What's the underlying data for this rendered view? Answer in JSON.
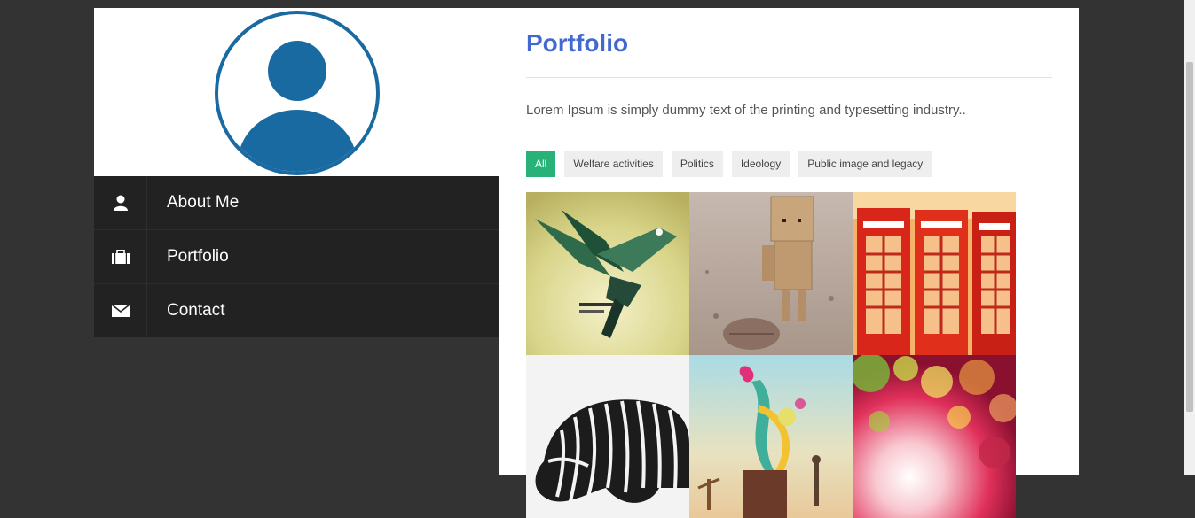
{
  "nav": {
    "items": [
      {
        "label": "About Me",
        "icon": "user-icon"
      },
      {
        "label": "Portfolio",
        "icon": "briefcase-icon"
      },
      {
        "label": "Contact",
        "icon": "envelope-icon"
      }
    ]
  },
  "main": {
    "title": "Portfolio",
    "description": "Lorem Ipsum is simply dummy text of the printing and typesetting industry..",
    "filters": [
      "All",
      "Welfare activities",
      "Politics",
      "Ideology",
      "Public image and legacy"
    ],
    "active_filter": "All"
  },
  "colors": {
    "title": "#4169d0",
    "filter_active": "#28b27a",
    "avatar": "#1a6aa2",
    "nav_bg": "#222222",
    "page_bg": "#333333"
  },
  "gallery": [
    {
      "subject": "hummingbird-art"
    },
    {
      "subject": "cardboard-robot"
    },
    {
      "subject": "red-phone-booths"
    },
    {
      "subject": "zebra"
    },
    {
      "subject": "paint-splash-surreal"
    },
    {
      "subject": "bokeh-colors"
    }
  ]
}
